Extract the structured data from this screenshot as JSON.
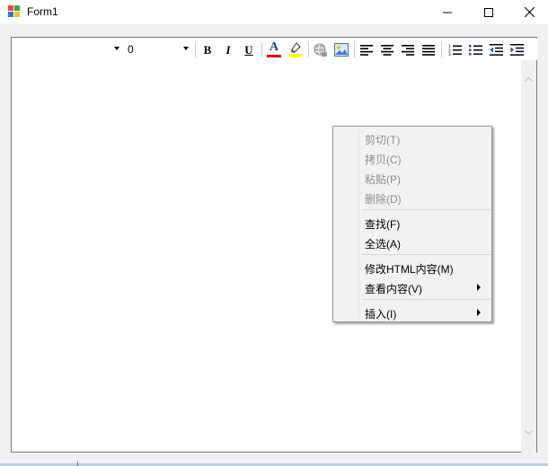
{
  "window": {
    "title": "Form1",
    "icon": "windows-form-icon",
    "controls": [
      "minimize-icon",
      "maximize-icon",
      "close-icon"
    ]
  },
  "toolbar": {
    "font_name": "",
    "font_size": "0",
    "buttons": {
      "bold": "B",
      "italic": "I",
      "underline": "U",
      "font_color": "A"
    },
    "colors": {
      "font_color_bar": "#e00000",
      "highlight_bar": "#ffff00",
      "accent": "#1f4e9c"
    },
    "icons": [
      "bold-icon",
      "italic-icon",
      "underline-icon",
      "font-color-icon",
      "highlight-icon",
      "link-icon",
      "image-icon",
      "align-left-icon",
      "align-center-icon",
      "align-right-icon",
      "justify-icon",
      "numbered-list-icon",
      "bulleted-list-icon",
      "outdent-icon",
      "indent-icon"
    ]
  },
  "context_menu": {
    "items": [
      {
        "label": "剪切(T)",
        "enabled": false
      },
      {
        "label": "拷贝(C)",
        "enabled": false
      },
      {
        "label": "粘贴(P)",
        "enabled": false
      },
      {
        "label": "删除(D)",
        "enabled": false
      },
      {
        "label": "查找(F)",
        "enabled": true
      },
      {
        "label": "全选(A)",
        "enabled": true
      },
      {
        "label": "修改HTML内容(M)",
        "enabled": true
      },
      {
        "label": "查看内容(V)",
        "enabled": true,
        "submenu": true
      },
      {
        "label": "插入(I)",
        "enabled": true,
        "submenu": true
      }
    ]
  }
}
